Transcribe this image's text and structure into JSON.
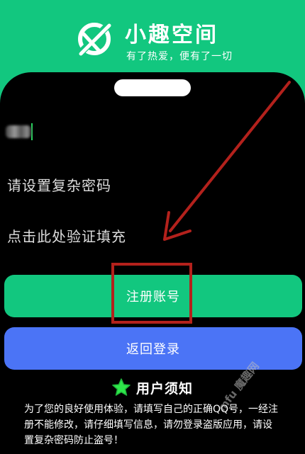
{
  "header": {
    "title": "小趣空间",
    "slogan": "有了热爱，便有了一切",
    "logo_icon": "planet-ring-icon"
  },
  "form": {
    "account_value_obscured": true,
    "password_placeholder": "请设置复杂密码",
    "verify_placeholder": "点击此处验证填充"
  },
  "buttons": {
    "register_label": "注册账号",
    "back_login_label": "返回登录"
  },
  "notice": {
    "title": "用户须知",
    "icon": "star-icon",
    "body": "为了您的良好使用体验，请填写自己的正确QQ号，一经注册不能修改，请仔细填写信息，请勿登录盗版应用，请设置复杂密码防止盗号！"
  },
  "watermark": {
    "text": "mfu 魔趣网"
  },
  "colors": {
    "brand_green": "#12c77f",
    "login_blue": "#4b74f6",
    "annotation_red": "#b3211c",
    "star_green": "#2ee84a"
  }
}
